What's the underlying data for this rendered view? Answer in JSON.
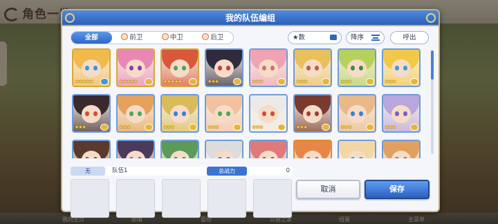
{
  "background": {
    "title": "角色一览",
    "bottom_nav": [
      "我的主页",
      "剧情",
      "冒险",
      "公会之家",
      "扭蛋",
      "主菜单"
    ]
  },
  "modal": {
    "title": "我的队伍编组"
  },
  "filters": {
    "tabs": [
      {
        "label": "全部",
        "active": true,
        "icon": null
      },
      {
        "label": "前卫",
        "active": false,
        "icon": "front-position-icon"
      },
      {
        "label": "中卫",
        "active": false,
        "icon": "middle-position-icon"
      },
      {
        "label": "后卫",
        "active": false,
        "icon": "back-position-icon"
      }
    ],
    "sort_key": "★数",
    "sort_order": "降序",
    "call_out": "呼出"
  },
  "roster": {
    "rows": [
      [
        {
          "frame": "gold",
          "hair": "#f2b94c",
          "eyes": "#3a9ad9",
          "stars": "★★★★★",
          "tag": "#3a9ad9"
        },
        {
          "frame": "gold",
          "hair": "#e987b4",
          "eyes": "#7e3fb8",
          "stars": "★★★★★",
          "tag": "#e6b63a"
        },
        {
          "frame": "gold",
          "hair": "#d8583a",
          "eyes": "#4aa85c",
          "stars": "★★★★★",
          "tag": "#e6b63a"
        },
        {
          "frame": "blue",
          "hair": "#2f2b3d",
          "eyes": "#c23a4a",
          "stars": "★★★",
          "tag": "#e6b63a"
        },
        {
          "frame": "blue",
          "hair": "#f0a3b2",
          "eyes": "#d46b80",
          "stars": "★★★",
          "tag": "#e6b63a"
        },
        {
          "frame": "blue",
          "hair": "#e8c05c",
          "eyes": "#c05a3a",
          "stars": "★★★",
          "tag": "#e6b63a"
        },
        {
          "frame": "blue",
          "hair": "#b6d25c",
          "eyes": "#3c8a4a",
          "stars": "★★★",
          "tag": "#e6b63a"
        },
        {
          "frame": "blue",
          "hair": "#f1c94a",
          "eyes": "#3a9ad9",
          "stars": "★★★",
          "tag": "#e6b63a"
        }
      ],
      [
        {
          "frame": "blue",
          "hair": "#3a2a2e",
          "eyes": "#d24a3a",
          "stars": "★★★",
          "tag": "#e6b63a"
        },
        {
          "frame": "blue",
          "hair": "#e6a25c",
          "eyes": "#4aa85c",
          "stars": "★★★",
          "tag": "#e6b63a"
        },
        {
          "frame": "blue",
          "hair": "#d9bb5a",
          "eyes": "#3a7fd9",
          "stars": "★★★",
          "tag": "#e6b63a"
        },
        {
          "frame": "blue",
          "hair": "#f2c2a0",
          "eyes": "#4aa85c",
          "stars": "★★★",
          "tag": "#e6b63a"
        },
        {
          "frame": "blue",
          "hair": "#eceae8",
          "eyes": "#d24a3a",
          "stars": "★★★",
          "tag": "#e6b63a"
        },
        {
          "frame": "blue",
          "hair": "#7a3a2e",
          "eyes": "#a23a3a",
          "stars": "★★★",
          "tag": "#e6b63a"
        },
        {
          "frame": "blue",
          "hair": "#e9b98a",
          "eyes": "#3a7fd9",
          "stars": "★★★",
          "tag": "#e6b63a"
        },
        {
          "frame": "blue",
          "hair": "#b8a6dc",
          "eyes": "#7a5ac9",
          "stars": "★★★",
          "tag": "#e6b63a"
        }
      ],
      [
        {
          "frame": "blue",
          "hair": "#5a3a2e",
          "eyes": "#a23a3a",
          "stars": "",
          "tag": ""
        },
        {
          "frame": "blue",
          "hair": "#4a3a5c",
          "eyes": "#7a5ac9",
          "stars": "",
          "tag": ""
        },
        {
          "frame": "blue",
          "hair": "#5c9a5a",
          "eyes": "#3c8a4a",
          "stars": "",
          "tag": ""
        },
        {
          "frame": "blue",
          "hair": "#dcdcdc",
          "eyes": "#3a7fd9",
          "stars": "",
          "tag": ""
        },
        {
          "frame": "blue",
          "hair": "#e07a7a",
          "eyes": "#c23a4a",
          "stars": "",
          "tag": ""
        },
        {
          "frame": "orange",
          "hair": "#e8864a",
          "eyes": "#c05a3a",
          "stars": "",
          "tag": ""
        },
        {
          "frame": "blue",
          "hair": "#f2d7a6",
          "eyes": "#3a9ad9",
          "stars": "",
          "tag": ""
        },
        {
          "frame": "blue",
          "hair": "#e2a060",
          "eyes": "#c05a3a",
          "stars": "",
          "tag": ""
        }
      ]
    ]
  },
  "party": {
    "index_label": "无",
    "name": "队伍1",
    "power_label": "总战力",
    "power_value": "0",
    "slot_count": 5
  },
  "buttons": {
    "cancel": "取消",
    "save": "保存"
  },
  "colors": {
    "accent": "#2f66c4",
    "frame_gold": "#d9a73a",
    "frame_blue": "#6f9bd8",
    "header_blue": "#3a74d0"
  }
}
